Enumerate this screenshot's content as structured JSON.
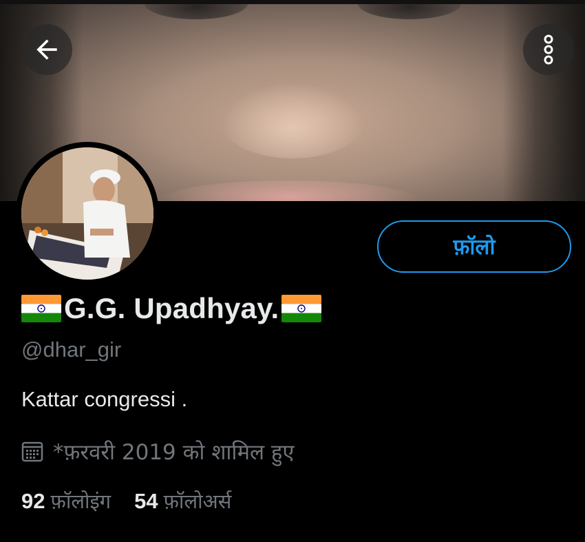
{
  "header": {
    "back_icon": "arrow-left-icon",
    "more_icon": "more-vertical-icon"
  },
  "profile": {
    "display_name": "G.G. Upadhyay.",
    "name_prefix_emoji": "india-flag-icon",
    "name_suffix_emoji": "india-flag-icon",
    "handle": "@dhar_gir",
    "bio": "Kattar congressi .",
    "joined": "*फ़रवरी 2019 को शामिल हुए",
    "joined_icon": "calendar-icon"
  },
  "actions": {
    "follow_label": "फ़ॉलो"
  },
  "stats": {
    "following_count": "92",
    "following_label": "फ़ॉलोइंग",
    "followers_count": "54",
    "followers_label": "फ़ॉलोअर्स"
  },
  "colors": {
    "accent": "#1d9bf0",
    "background": "#000000",
    "primary_text": "#e7e9ea",
    "secondary_text": "#71767b"
  }
}
